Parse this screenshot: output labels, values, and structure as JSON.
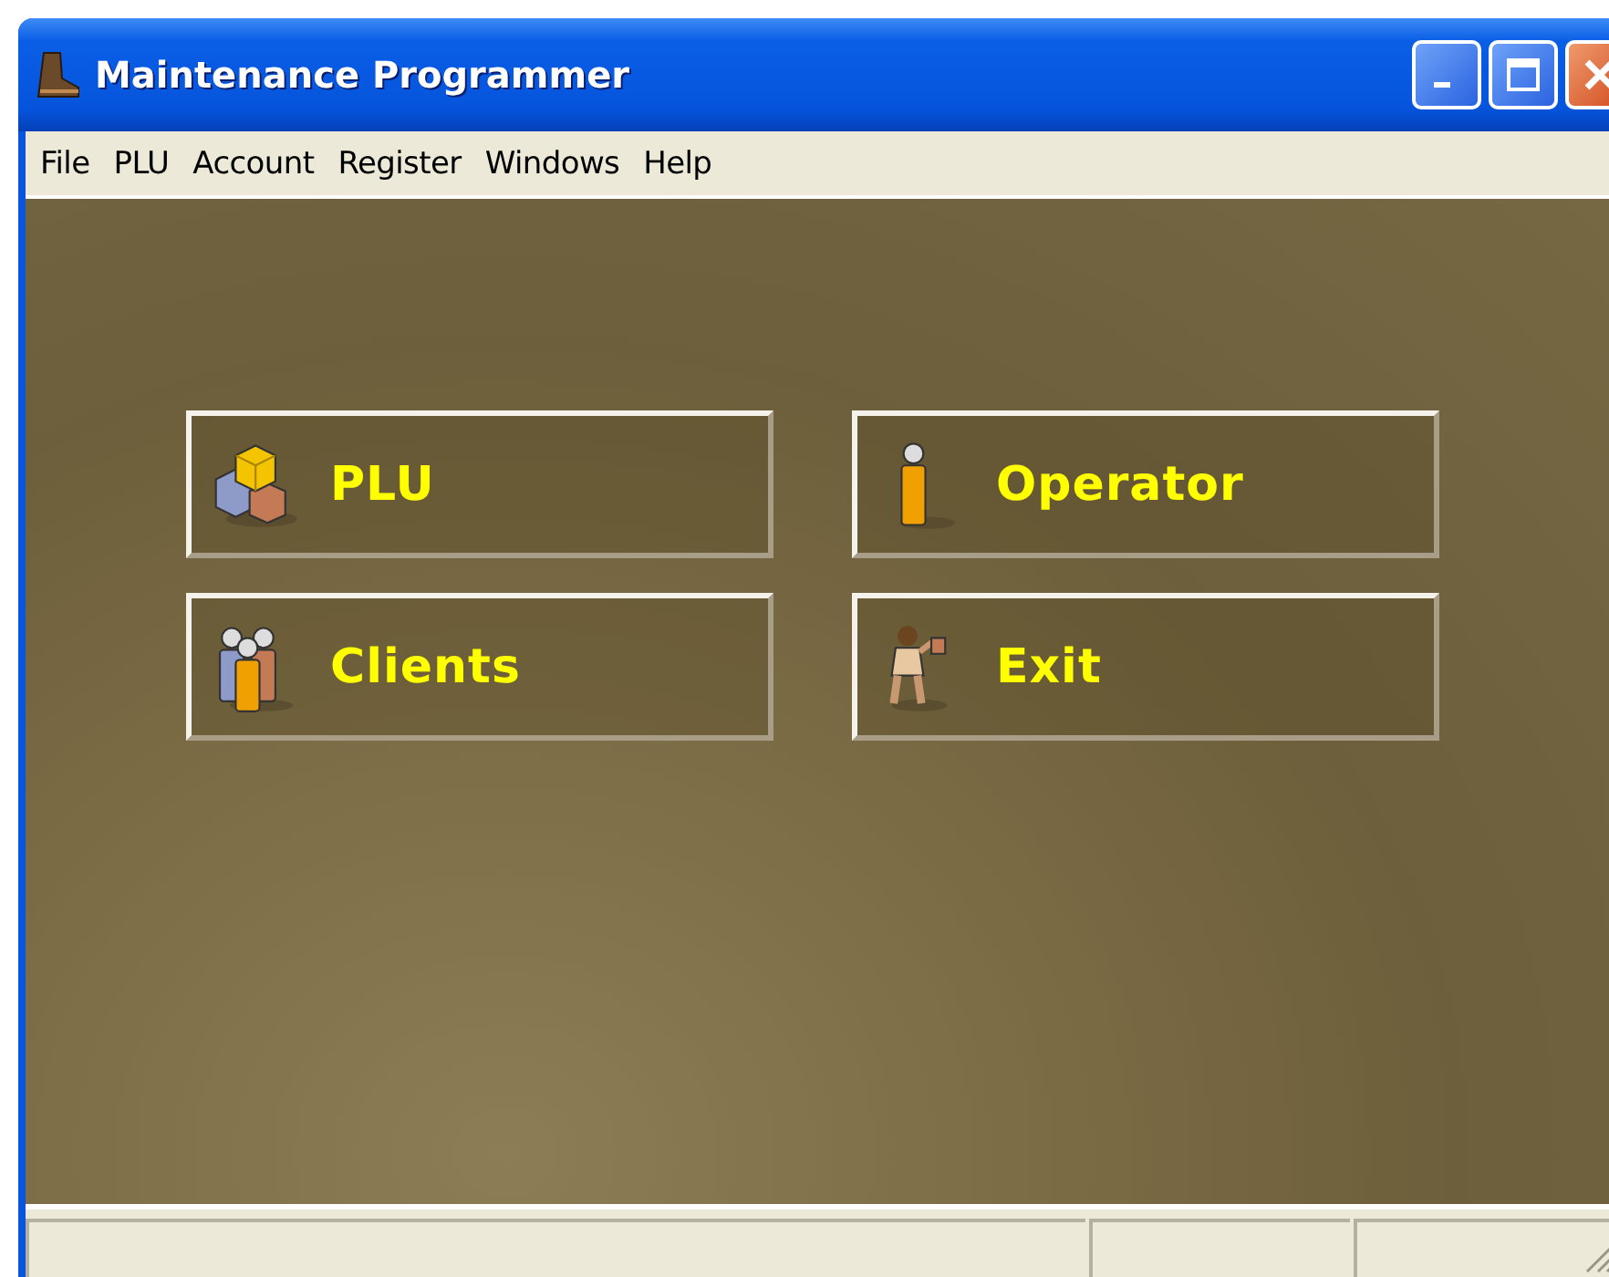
{
  "window": {
    "title": "Maintenance Programmer"
  },
  "menu": [
    "File",
    "PLU",
    "Account",
    "Register",
    "Windows",
    "Help"
  ],
  "buttons": [
    {
      "label": "PLU",
      "kind": "cubes"
    },
    {
      "label": "Operator",
      "kind": "person"
    },
    {
      "label": "Clients",
      "kind": "group"
    },
    {
      "label": "Exit",
      "kind": "walker"
    }
  ]
}
